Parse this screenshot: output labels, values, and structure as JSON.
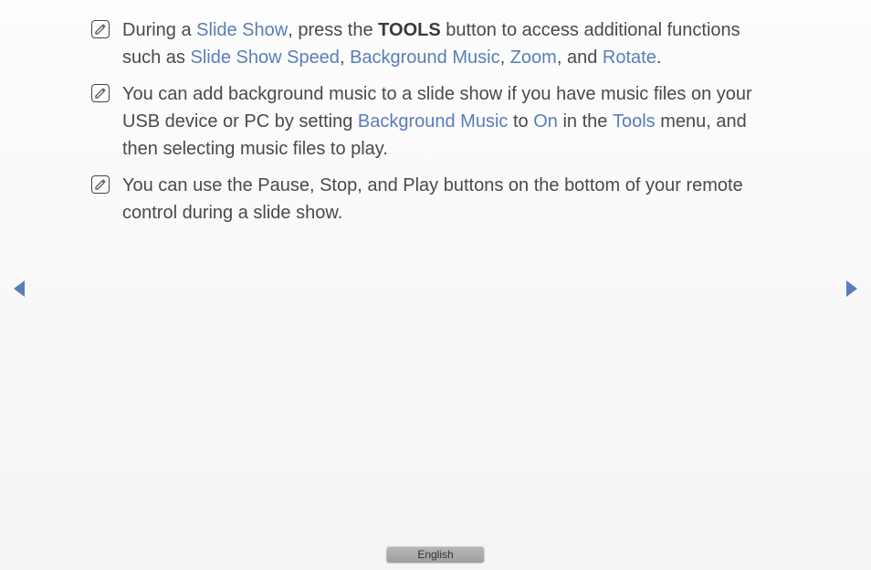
{
  "notes": [
    {
      "pre1": "During a ",
      "link1": "Slide Show",
      "mid1": ", press the ",
      "bold": "TOOLS",
      "mid2": " button to access additional functions such as ",
      "link2": "Slide Show Speed",
      "sep1": ", ",
      "link3": "Background Music",
      "sep2": ", ",
      "link4": "Zoom",
      "sep3": ", and ",
      "link5": "Rotate",
      "end": "."
    },
    {
      "pre1": "You can add background music to a slide show if you have music files on your USB device or PC by setting ",
      "link1": "Background Music",
      "mid1": " to ",
      "link2": "On",
      "mid2": " in the ",
      "link3": "Tools",
      "end": " menu, and then selecting music files to play."
    },
    {
      "text": "You can use the Pause, Stop, and Play buttons on the bottom of your remote control during a slide show."
    }
  ],
  "footer": {
    "label": "English"
  }
}
